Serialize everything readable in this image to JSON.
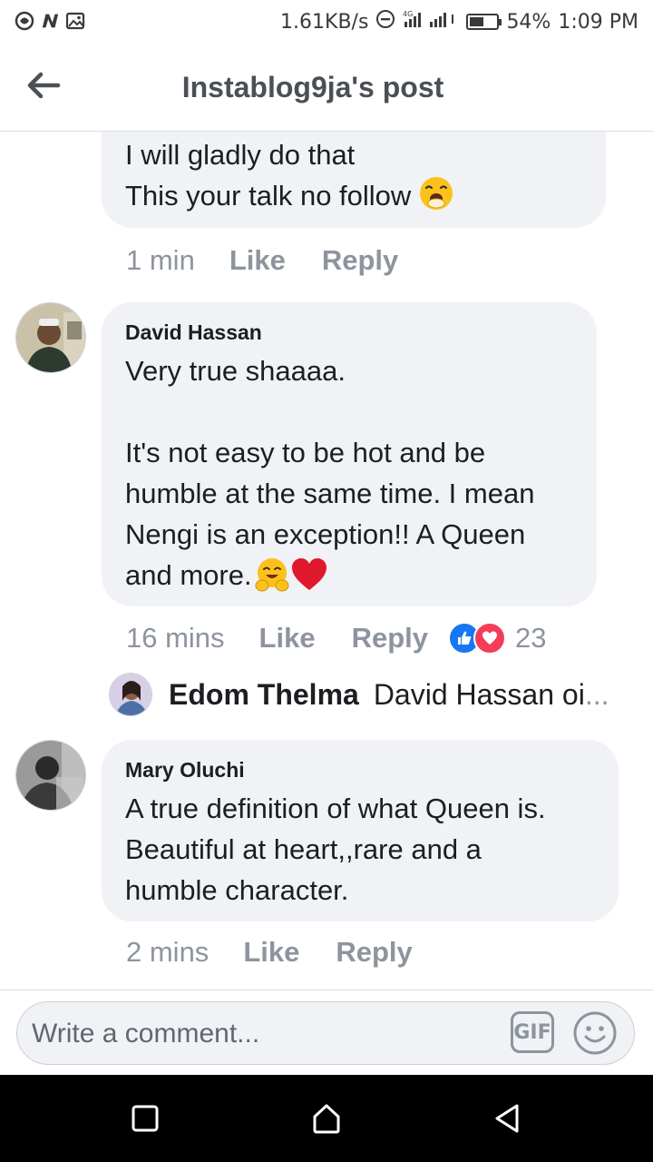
{
  "status_bar": {
    "left_icons": [
      "app-icon",
      "n-icon",
      "image-icon"
    ],
    "net_speed": "1.61KB/s",
    "battery_percent": "54%",
    "battery_level": 0.54,
    "time": "1:09 PM"
  },
  "header": {
    "title": "Instablog9ja's post",
    "back_icon": "back-arrow-icon"
  },
  "comments": [
    {
      "text": "I will gladly do that\nThis your talk no follow",
      "emoji": "yawning-face",
      "time": "1 min",
      "like": "Like",
      "reply": "Reply"
    },
    {
      "author": "David Hassan",
      "text": "Very true shaaaa.\n\nIt's not easy to be hot and be\nhumble at the same time. I mean\nNengi is an exception!! A Queen\nand more.",
      "emojis": [
        "hugging-face",
        "red-heart"
      ],
      "time": "16 mins",
      "like": "Like",
      "reply": "Reply",
      "reaction_icons": [
        "like-icon",
        "love-icon"
      ],
      "reaction_count": "23",
      "reply_preview": {
        "name": "Edom Thelma",
        "text": "David Hassan oi",
        "ellipsis": "..."
      }
    },
    {
      "author": "Mary Oluchi",
      "text": "A true definition of what Queen is.\nBeautiful at heart,,rare and a\nhumble character.",
      "time": "2 mins",
      "like": "Like",
      "reply": "Reply"
    }
  ],
  "composer": {
    "placeholder": "Write a comment...",
    "gif_label": "GIF"
  },
  "colors": {
    "bubble": "#f0f2f5",
    "muted": "#8d949e",
    "header_text": "#4b4f56",
    "like_blue": "#1877f2",
    "love_red": "#f33e58"
  }
}
